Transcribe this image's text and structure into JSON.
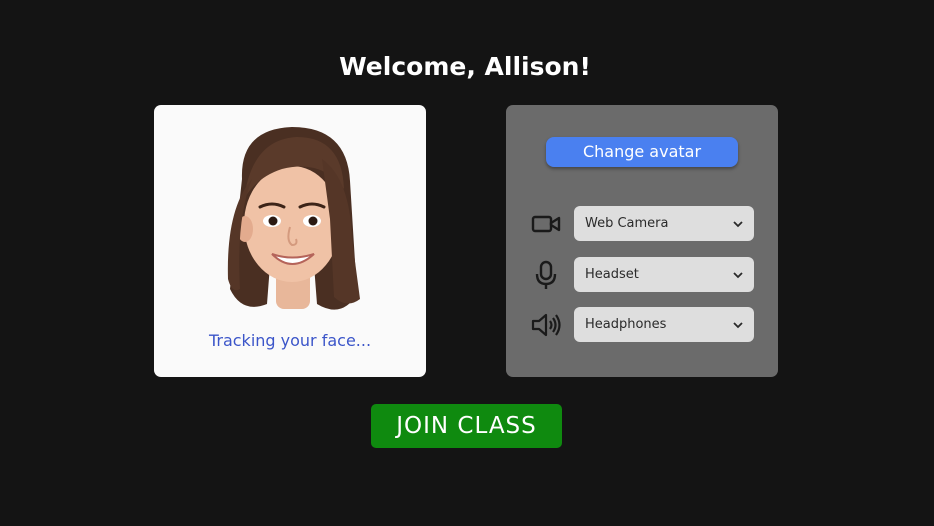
{
  "header": {
    "welcome_text": "Welcome, Allison!"
  },
  "avatar_card": {
    "status_text": "Tracking your face..."
  },
  "settings": {
    "change_avatar_label": "Change avatar",
    "devices": [
      {
        "icon": "video-camera-icon",
        "value": "Web Camera"
      },
      {
        "icon": "microphone-icon",
        "value": "Headset"
      },
      {
        "icon": "speaker-icon",
        "value": "Headphones"
      }
    ]
  },
  "join_label": "JOIN CLASS",
  "colors": {
    "background": "#141414",
    "accent_blue": "#4a80f0",
    "join_green": "#0f8a0f",
    "tracking_text": "#3b55c9"
  }
}
